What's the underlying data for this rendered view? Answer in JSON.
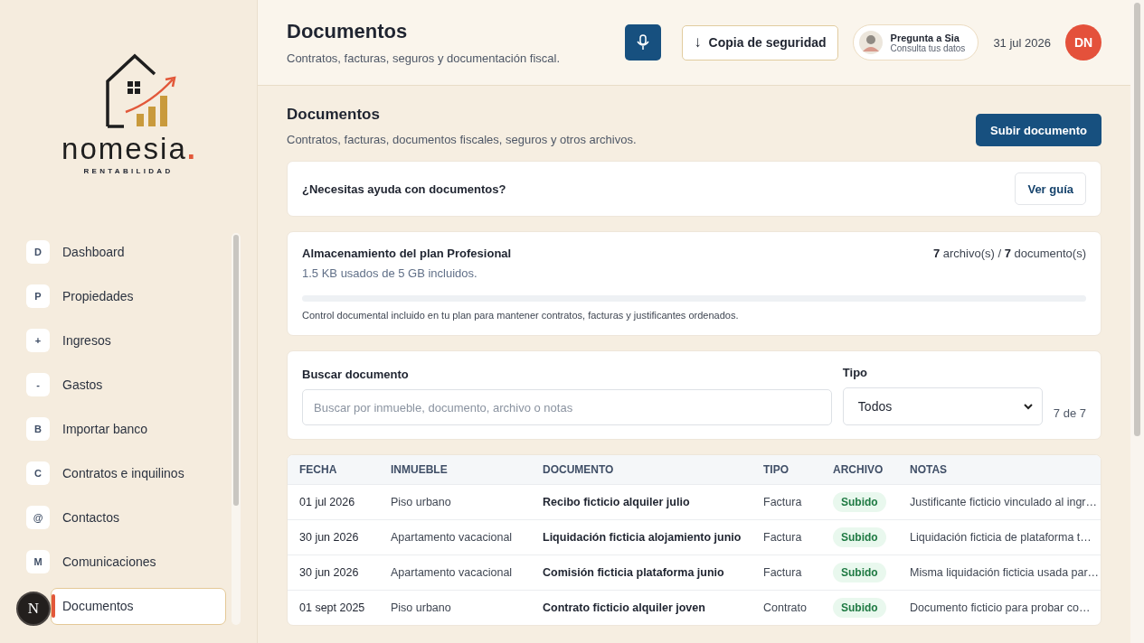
{
  "logo": {
    "name": "nomesia",
    "dot": ".",
    "tagline": "RENTABILIDAD"
  },
  "sidebar": {
    "items": [
      {
        "badge": "D",
        "label": "Dashboard",
        "selected": false
      },
      {
        "badge": "P",
        "label": "Propiedades",
        "selected": false
      },
      {
        "badge": "+",
        "label": "Ingresos",
        "selected": false
      },
      {
        "badge": "-",
        "label": "Gastos",
        "selected": false
      },
      {
        "badge": "B",
        "label": "Importar banco",
        "selected": false
      },
      {
        "badge": "C",
        "label": "Contratos e inquilinos",
        "selected": false
      },
      {
        "badge": "@",
        "label": "Contactos",
        "selected": false
      },
      {
        "badge": "M",
        "label": "Comunicaciones",
        "selected": false
      },
      {
        "label": "Documentos",
        "selected": true
      }
    ]
  },
  "help_bubble": "N",
  "header": {
    "title": "Documentos",
    "subtitle": "Contratos, facturas, seguros y documentación fiscal.",
    "backup": {
      "icon": "↓",
      "label": "Copia de seguridad"
    },
    "assistant": {
      "title": "Pregunta a Sia",
      "subtitle": "Consulta tus datos"
    },
    "date": "31 jul 2026",
    "avatar": "DN"
  },
  "section": {
    "title": "Documentos",
    "subtitle": "Contratos, facturas, documentos fiscales, seguros y otros archivos.",
    "upload_button": "Subir documento"
  },
  "help_card": {
    "text": "¿Necesitas ayuda con documentos?",
    "button": "Ver guía"
  },
  "storage": {
    "title": "Almacenamiento del plan Profesional",
    "usage": "1.5 KB usados de 5 GB incluidos.",
    "count": "**7** archivo(s) / **7** documento(s)",
    "level": 0,
    "note": "Control documental incluido en tu plan para mantener contratos, facturas y justificantes ordenados."
  },
  "filters": {
    "search_label": "Buscar documento",
    "search_placeholder": "Buscar por inmueble, documento, archivo o notas",
    "type_label": "Tipo",
    "type_value": "Todos",
    "result_count": "7 de 7"
  },
  "table": {
    "columns": [
      "FECHA",
      "INMUEBLE",
      "DOCUMENTO",
      "TIPO",
      "ARCHIVO",
      "NOTAS"
    ],
    "rows": [
      {
        "date": "01 jul 2026",
        "property": "Piso urbano",
        "document": "Recibo ficticio alquiler julio",
        "type": "Factura",
        "file": "Subido",
        "notes": "Justificante ficticio vinculado al ingr…"
      },
      {
        "date": "30 jun 2026",
        "property": "Apartamento vacacional",
        "document": "Liquidación ficticia alojamiento junio",
        "type": "Factura",
        "file": "Subido",
        "notes": "Liquidación ficticia de plataforma t…"
      },
      {
        "date": "30 jun 2026",
        "property": "Apartamento vacacional",
        "document": "Comisión ficticia plataforma junio",
        "type": "Factura",
        "file": "Subido",
        "notes": "Misma liquidación ficticia usada par…"
      },
      {
        "date": "01 sept 2025",
        "property": "Piso urbano",
        "document": "Contrato ficticio alquiler joven",
        "type": "Contrato",
        "file": "Subido",
        "notes": "Documento ficticio para probar co…"
      }
    ]
  }
}
